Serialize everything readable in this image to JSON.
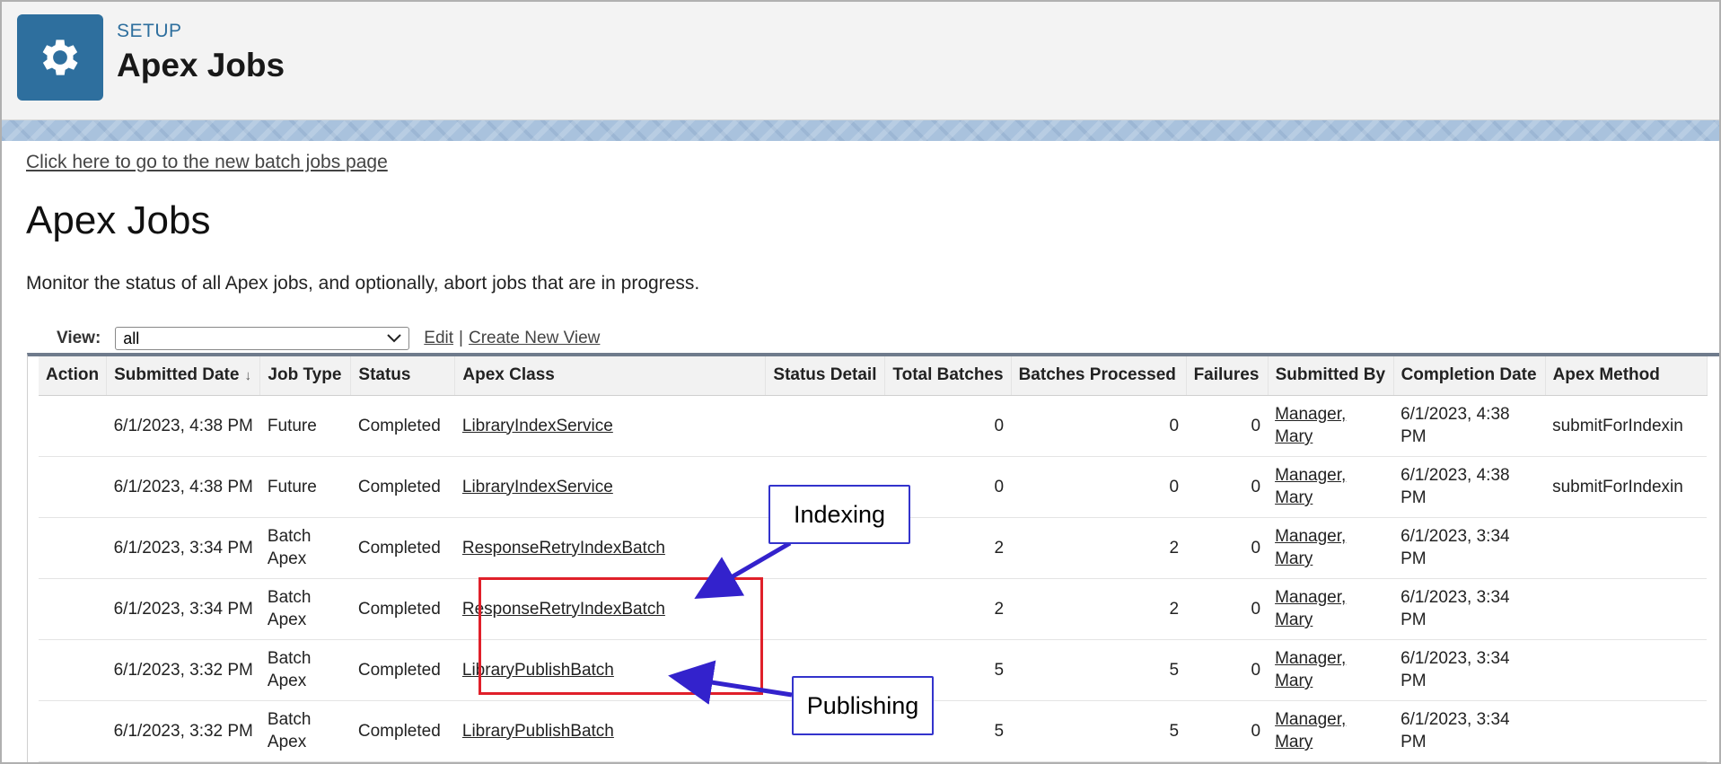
{
  "header": {
    "eyebrow": "SETUP",
    "title": "Apex Jobs",
    "icon": "gear-icon"
  },
  "new_batch_link": "Click here to go to the new batch jobs page",
  "page": {
    "title": "Apex Jobs",
    "description": "Monitor the status of all Apex jobs, and optionally, abort jobs that are in progress."
  },
  "view": {
    "label": "View:",
    "selected": "all",
    "edit_link": "Edit",
    "separator": "|",
    "create_link": "Create New View"
  },
  "table": {
    "columns": [
      "Action",
      "Submitted Date",
      "Job Type",
      "Status",
      "Apex Class",
      "Status Detail",
      "Total Batches",
      "Batches Processed",
      "Failures",
      "Submitted By",
      "Completion Date",
      "Apex Method"
    ],
    "rows": [
      {
        "action": "",
        "submitted": "6/1/2023, 4:38 PM",
        "job_type": "Future",
        "status": "Completed",
        "apex_class": "LibraryIndexService",
        "status_detail": "",
        "total": "0",
        "processed": "0",
        "failures": "0",
        "submitted_by": "Manager, Mary",
        "completion": "6/1/2023, 4:38 PM",
        "method": "submitForIndexin"
      },
      {
        "action": "",
        "submitted": "6/1/2023, 4:38 PM",
        "job_type": "Future",
        "status": "Completed",
        "apex_class": "LibraryIndexService",
        "status_detail": "",
        "total": "0",
        "processed": "0",
        "failures": "0",
        "submitted_by": "Manager, Mary",
        "completion": "6/1/2023, 4:38 PM",
        "method": "submitForIndexin"
      },
      {
        "action": "",
        "submitted": "6/1/2023, 3:34 PM",
        "job_type": "Batch Apex",
        "status": "Completed",
        "apex_class": "ResponseRetryIndexBatch",
        "status_detail": "",
        "total": "2",
        "processed": "2",
        "failures": "0",
        "submitted_by": "Manager, Mary",
        "completion": "6/1/2023, 3:34 PM",
        "method": ""
      },
      {
        "action": "",
        "submitted": "6/1/2023, 3:34 PM",
        "job_type": "Batch Apex",
        "status": "Completed",
        "apex_class": "ResponseRetryIndexBatch",
        "status_detail": "",
        "total": "2",
        "processed": "2",
        "failures": "0",
        "submitted_by": "Manager, Mary",
        "completion": "6/1/2023, 3:34 PM",
        "method": ""
      },
      {
        "action": "",
        "submitted": "6/1/2023, 3:32 PM",
        "job_type": "Batch Apex",
        "status": "Completed",
        "apex_class": "LibraryPublishBatch",
        "status_detail": "",
        "total": "5",
        "processed": "5",
        "failures": "0",
        "submitted_by": "Manager, Mary",
        "completion": "6/1/2023, 3:34 PM",
        "method": ""
      },
      {
        "action": "",
        "submitted": "6/1/2023, 3:32 PM",
        "job_type": "Batch Apex",
        "status": "Completed",
        "apex_class": "LibraryPublishBatch",
        "status_detail": "",
        "total": "5",
        "processed": "5",
        "failures": "0",
        "submitted_by": "Manager, Mary",
        "completion": "6/1/2023, 3:34 PM",
        "method": ""
      }
    ]
  },
  "annotations": {
    "indexing": "Indexing",
    "publishing": "Publishing",
    "arrow_color": "#3322cc",
    "highlight_color": "#e0202a"
  },
  "colors": {
    "brand": "#2e6f9e"
  }
}
